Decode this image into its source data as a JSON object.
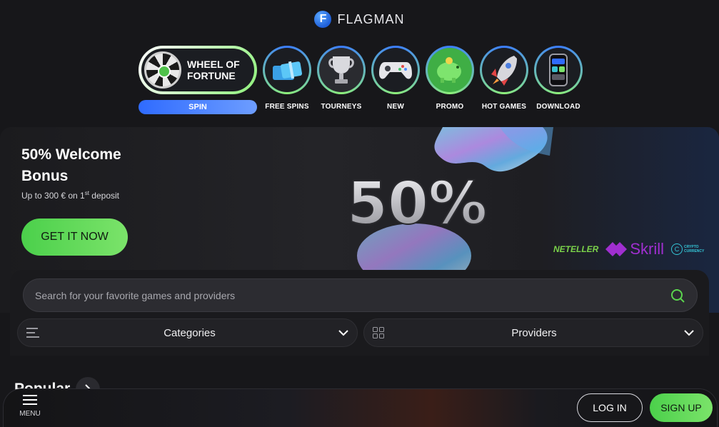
{
  "brand": {
    "name": "FLAGMAN",
    "badge_letter": "F"
  },
  "categories": {
    "wheel": {
      "title": "WHEEL OF FORTUNE",
      "button": "SPIN"
    },
    "items": [
      {
        "label": "FREE SPINS",
        "icon": "gift-icon"
      },
      {
        "label": "TOURNEYS",
        "icon": "trophy-icon"
      },
      {
        "label": "NEW",
        "icon": "gamepad-icon"
      },
      {
        "label": "PROMO",
        "icon": "piggy-bank-icon"
      },
      {
        "label": "HOT GAMES",
        "icon": "rocket-icon"
      },
      {
        "label": "DOWNLOAD",
        "icon": "phone-icon"
      }
    ]
  },
  "hero": {
    "title": "50% Welcome Bonus",
    "subtitle_prefix": "Up to 300 € on 1",
    "subtitle_sup": "st",
    "subtitle_suffix": " deposit",
    "cta": "GET IT NOW",
    "art_text": "50%",
    "payments": {
      "neteller": "NETELLER",
      "skrill": "Skrill",
      "crypto_letter": "C",
      "crypto_line1": "CRYPTO",
      "crypto_line2": "CURRENCY"
    }
  },
  "search": {
    "placeholder": "Search for your favorite games and providers",
    "value": ""
  },
  "filters": {
    "categories": "Categories",
    "providers": "Providers"
  },
  "popular": {
    "title": "Popular"
  },
  "bottombar": {
    "menu": "MENU",
    "login": "LOG IN",
    "signup": "SIGN UP"
  },
  "colors": {
    "accent_green": "#5bd54e",
    "accent_blue": "#2f6bff",
    "background": "#17171a"
  }
}
